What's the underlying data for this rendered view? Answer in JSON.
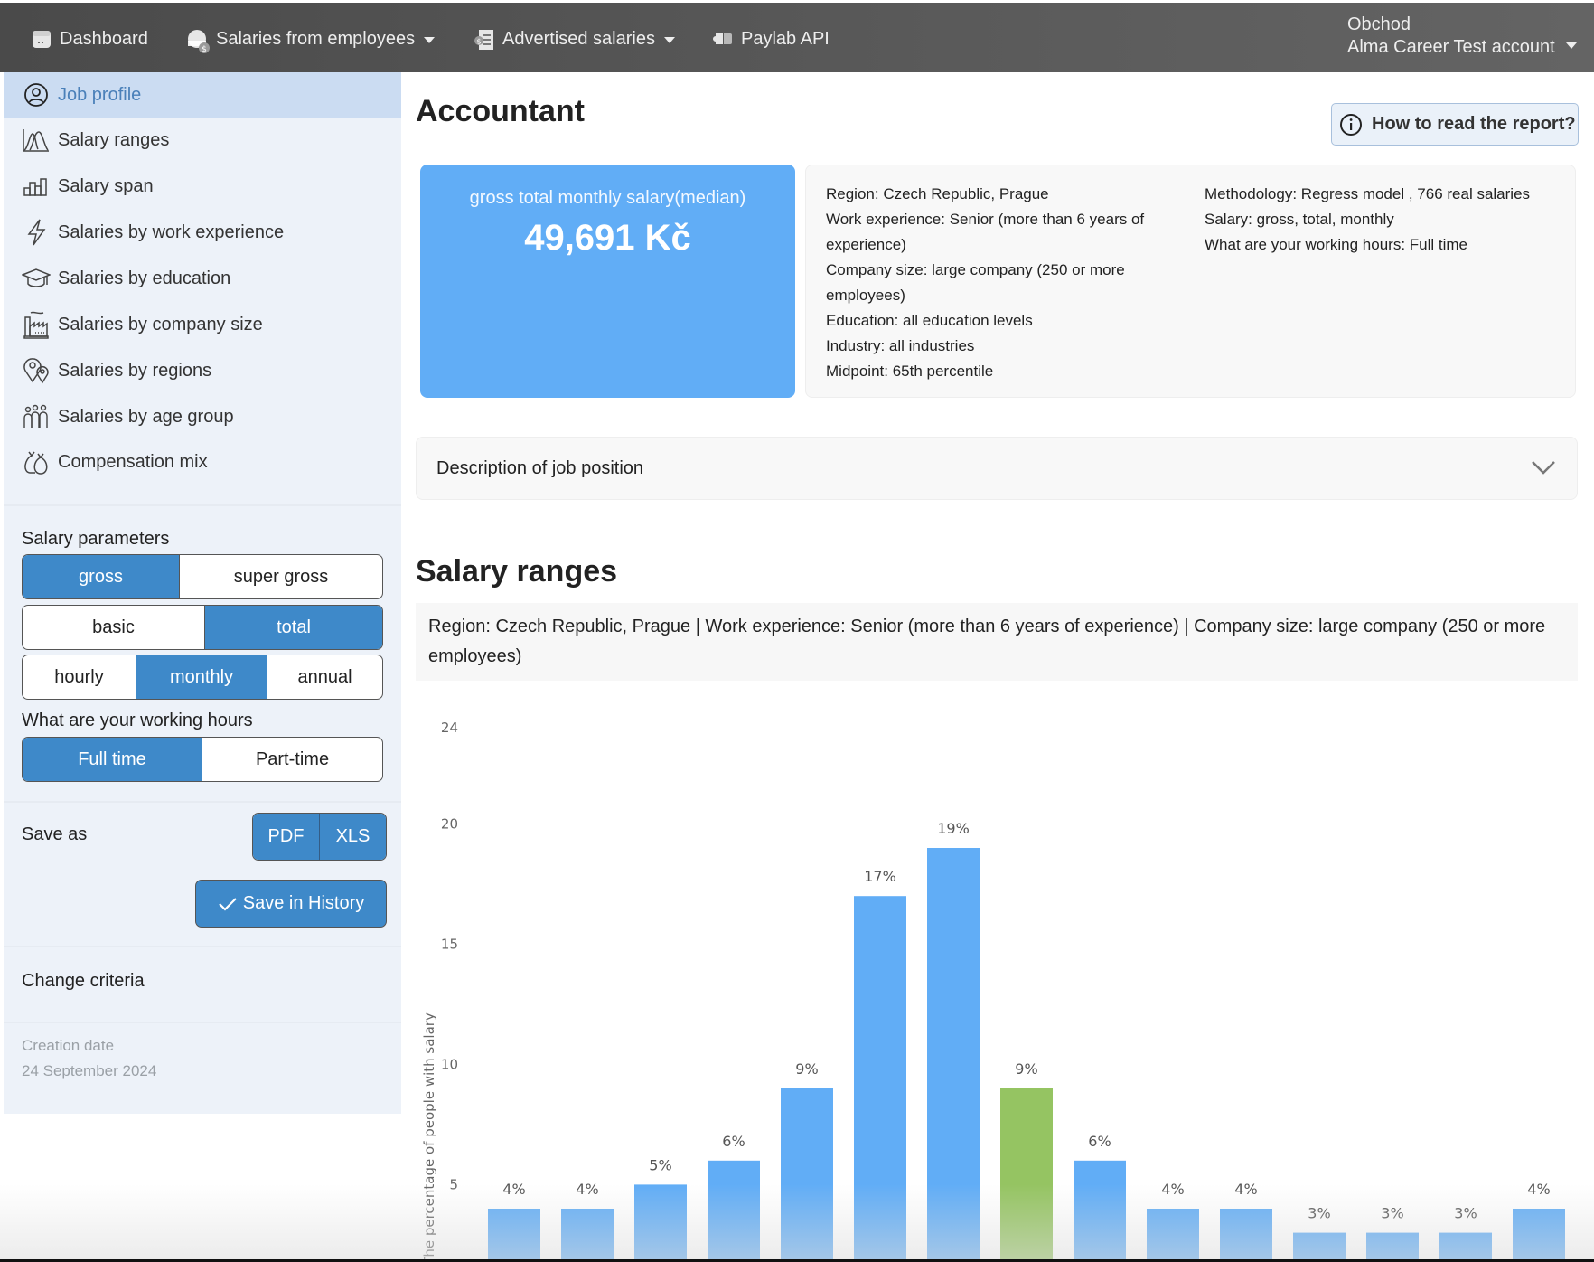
{
  "navbar": {
    "items": [
      {
        "label": "Dashboard",
        "icon": "dashboard-icon",
        "dropdown": false
      },
      {
        "label": "Salaries from employees",
        "icon": "employee-salary-icon",
        "dropdown": true
      },
      {
        "label": "Advertised salaries",
        "icon": "advertised-salary-icon",
        "dropdown": true
      },
      {
        "label": "Paylab API",
        "icon": "api-puzzle-icon",
        "dropdown": false
      }
    ],
    "account": {
      "org": "Obchod",
      "name": "Alma Career Test account"
    }
  },
  "sidebar": {
    "items": [
      {
        "label": "Job profile",
        "icon": "user-circle-icon",
        "active": true
      },
      {
        "label": "Salary ranges",
        "icon": "distribution-icon",
        "active": false
      },
      {
        "label": "Salary span",
        "icon": "bar-chart-icon",
        "active": false
      },
      {
        "label": "Salaries by work experience",
        "icon": "lightning-icon",
        "active": false
      },
      {
        "label": "Salaries by education",
        "icon": "graduation-cap-icon",
        "active": false
      },
      {
        "label": "Salaries by company size",
        "icon": "factory-icon",
        "active": false
      },
      {
        "label": "Salaries by regions",
        "icon": "map-pins-icon",
        "active": false
      },
      {
        "label": "Salaries by age group",
        "icon": "people-group-icon",
        "active": false
      },
      {
        "label": "Compensation mix",
        "icon": "money-bags-icon",
        "active": false
      }
    ],
    "salary_parameters": {
      "title": "Salary parameters",
      "row1": [
        {
          "label": "gross",
          "on": true
        },
        {
          "label": "super gross",
          "on": false
        }
      ],
      "row2": [
        {
          "label": "basic",
          "on": false
        },
        {
          "label": "total",
          "on": true
        }
      ],
      "row3": [
        {
          "label": "hourly",
          "on": false
        },
        {
          "label": "monthly",
          "on": true
        },
        {
          "label": "annual",
          "on": false
        }
      ]
    },
    "working_hours": {
      "title": "What are your working hours",
      "options": [
        {
          "label": "Full time",
          "on": true
        },
        {
          "label": "Part-time",
          "on": false
        }
      ]
    },
    "save_as": {
      "label": "Save as",
      "pdf": "PDF",
      "xls": "XLS"
    },
    "save_history": "Save in History",
    "change_criteria": "Change criteria",
    "creation": {
      "label": "Creation date",
      "date": "24 September 2024"
    }
  },
  "main": {
    "title": "Accountant",
    "how_to_read": "How to read the report?",
    "median": {
      "caption": "gross total monthly salary(median)",
      "value": "49,691 Kč"
    },
    "criteria_left": [
      "Region: Czech Republic, Prague",
      "Work experience: Senior (more than 6 years of experience)",
      "Company size: large company (250 or more employees)",
      "Education: all education levels",
      "Industry: all industries",
      "Midpoint: 65th percentile"
    ],
    "criteria_right": [
      "Methodology: Regress model , 766 real salaries",
      "Salary: gross, total, monthly",
      "What are your working hours: Full time"
    ],
    "description_accordion": "Description of job position",
    "section_title": "Salary ranges",
    "filter_summary": "Region: Czech Republic, Prague | Work experience: Senior (more than 6 years of experience) | Company size: large company (250 or more employees)"
  },
  "colors": {
    "accent": "#3e89c9",
    "bar": "#61adf6",
    "highlight_bar": "#95c462",
    "sidebar_bg": "#edf2f9",
    "active_item": "#cbdcf2"
  },
  "chart_data": {
    "type": "bar",
    "title": "Salary ranges",
    "ylabel": "The percentage of people with salary",
    "xlabel": "",
    "yticks": [
      5,
      10,
      15,
      20,
      24
    ],
    "ylim": [
      0,
      24
    ],
    "grid": false,
    "values": [
      4,
      4,
      5,
      6,
      9,
      17,
      19,
      9,
      6,
      4,
      4,
      3,
      3,
      3,
      4
    ],
    "labels": [
      "4%",
      "4%",
      "5%",
      "6%",
      "9%",
      "17%",
      "19%",
      "9%",
      "6%",
      "4%",
      "4%",
      "3%",
      "3%",
      "3%",
      "4%"
    ],
    "highlight_index": 7
  }
}
